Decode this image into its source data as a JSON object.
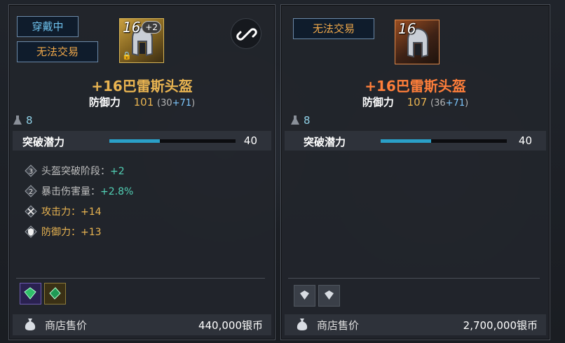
{
  "left": {
    "tags": {
      "equipped": "穿戴中",
      "untradable": "无法交易"
    },
    "item": {
      "enhance": "16",
      "enhance_bonus": "+2",
      "name": "+16巴雷斯头盔",
      "stat_label": "防御力",
      "stat_value": "101",
      "stat_base": "(30",
      "stat_plus": "+71",
      "stat_close": ")"
    },
    "level": "8",
    "potential": {
      "label": "突破潜力",
      "value": "40",
      "fill_fraction": 0.4
    },
    "effects": [
      {
        "icon": "diamond-3-icon",
        "label": "头盔突破阶段：",
        "value": "+2"
      },
      {
        "icon": "diamond-2-icon",
        "label": "暴击伤害量：",
        "value": "+2.8%"
      },
      {
        "icon": "crossed-swords-icon",
        "label": "攻击力：",
        "value": "+14"
      },
      {
        "icon": "shield-icon",
        "label": "防御力：",
        "value": "+13"
      }
    ],
    "sell": {
      "label": "商店售价",
      "price": "440,000银币"
    }
  },
  "right": {
    "tags": {
      "untradable": "无法交易"
    },
    "item": {
      "enhance": "16",
      "name": "+16巴雷斯头盔",
      "stat_label": "防御力",
      "stat_value": "107",
      "stat_base": "(36",
      "stat_plus": "+71",
      "stat_close": ")"
    },
    "level": "8",
    "potential": {
      "label": "突破潜力",
      "value": "40",
      "fill_fraction": 0.4
    },
    "sell": {
      "label": "商店售价",
      "price": "2,700,000银币"
    }
  },
  "colors": {
    "accent_gold": "#e9b451",
    "accent_orange": "#ff7e3a",
    "accent_cyan": "#52d0b5",
    "bar_fill": "#2aa0c8"
  }
}
